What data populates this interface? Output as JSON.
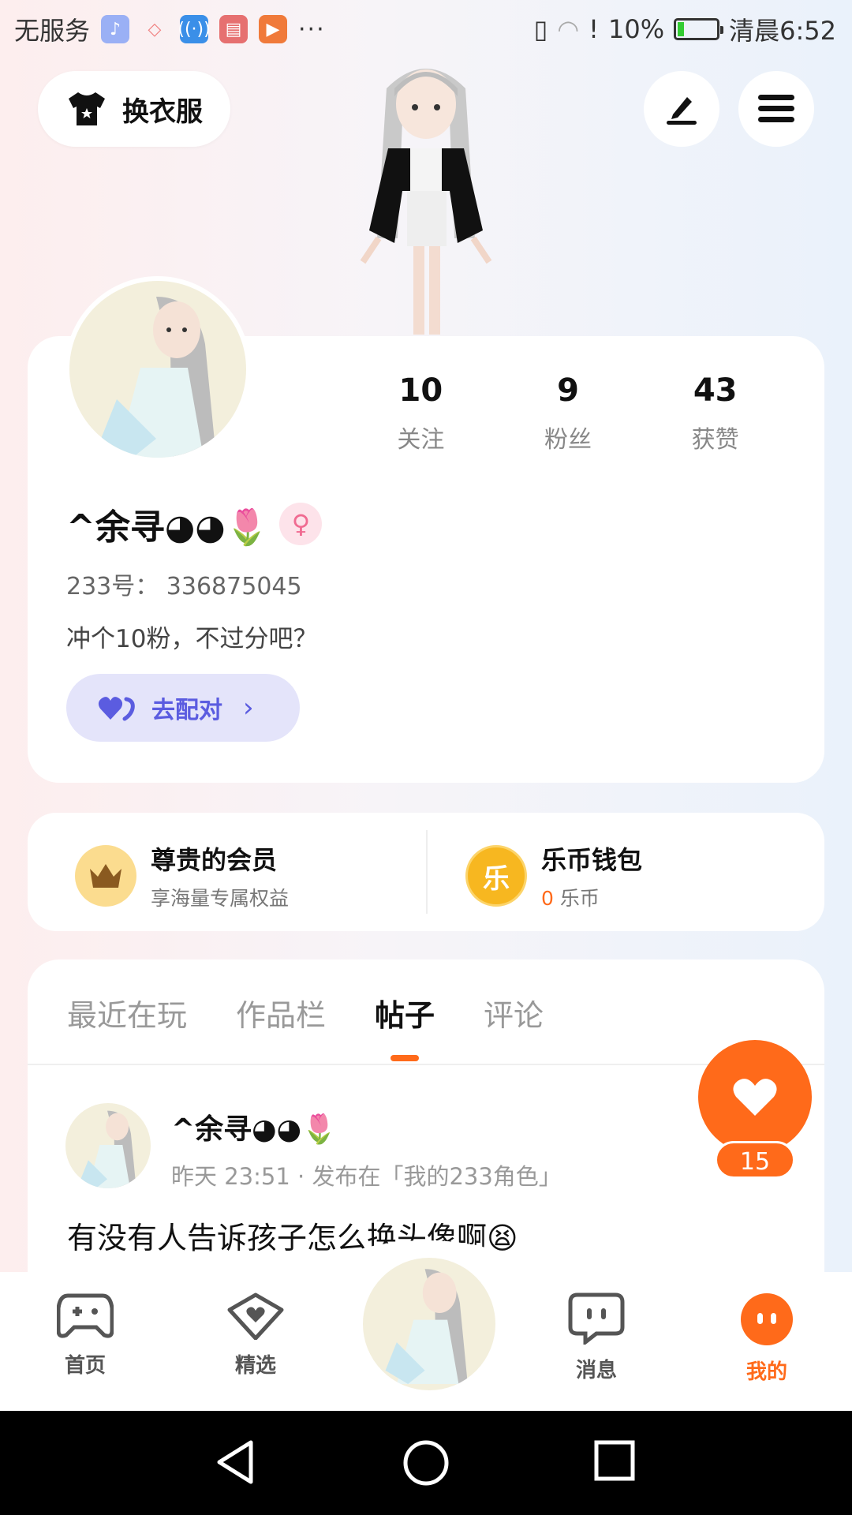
{
  "status_bar": {
    "carrier": "无服务",
    "app_icons": [
      "music-icon",
      "tag-icon",
      "hotspot-icon",
      "album-icon",
      "video-icon"
    ],
    "more": "···",
    "battery": "10%",
    "time": "清晨6:52"
  },
  "top": {
    "dress_label": "换衣服"
  },
  "profile": {
    "stats": [
      {
        "num": "10",
        "label": "关注"
      },
      {
        "num": "9",
        "label": "粉丝"
      },
      {
        "num": "43",
        "label": "获赞"
      }
    ],
    "nickname": "^余寻◕◕🌷",
    "gender": "♀",
    "account_id": "233号： 336875045",
    "bio": "冲个10粉，不过分吧？",
    "match_label": "去配对"
  },
  "member": {
    "title": "尊贵的会员",
    "subtitle": "享海量专属权益"
  },
  "wallet": {
    "icon_text": "乐",
    "title": "乐币钱包",
    "balance": "0",
    "unit": "乐币"
  },
  "tabs": [
    "最近在玩",
    "作品栏",
    "帖子",
    "评论"
  ],
  "active_tab": "帖子",
  "post": {
    "author": "^余寻◕◕🌷",
    "meta": "昨天 23:51 · 发布在「我的233角色」",
    "text": "有没有人告诉孩子怎么换头像啊😫"
  },
  "like_count": "15",
  "bottom_nav": [
    {
      "label": "首页",
      "icon": "gamepad-icon"
    },
    {
      "label": "精选",
      "icon": "heart-badge-icon"
    },
    {
      "label": "消息",
      "icon": "chat-icon"
    },
    {
      "label": "我的",
      "icon": "profile-dots-icon"
    }
  ],
  "colors": {
    "accent": "#ff6a1a",
    "match": "#5b5ce0"
  }
}
